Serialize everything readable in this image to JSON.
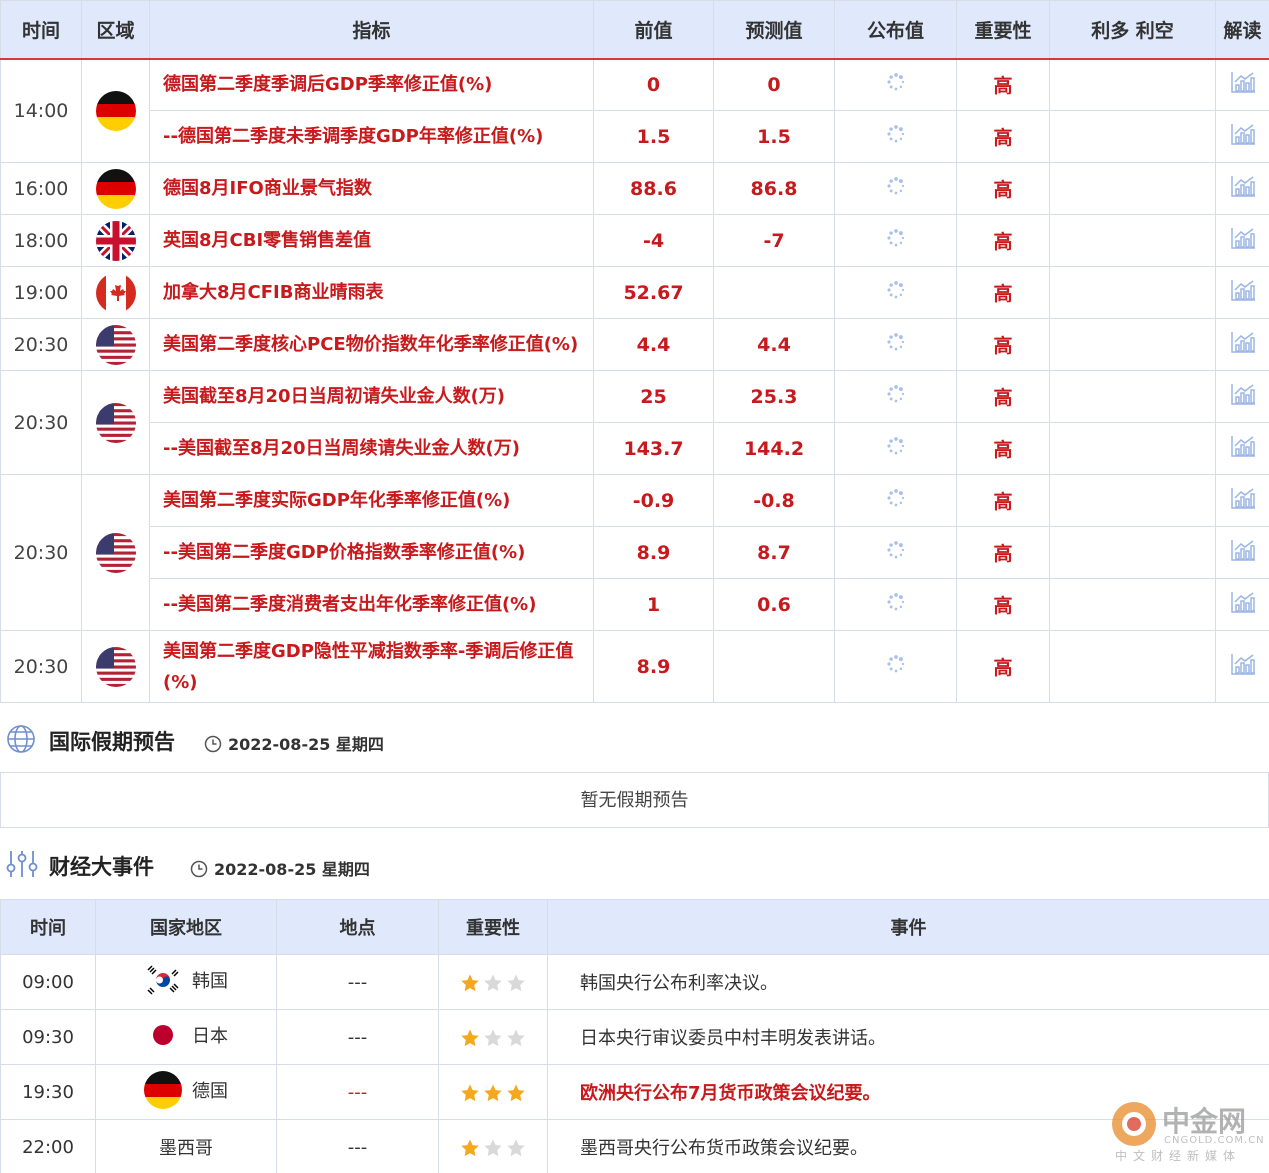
{
  "econ_table": {
    "headers": {
      "time": "时间",
      "region": "区域",
      "indicator": "指标",
      "previous": "前值",
      "forecast": "预测值",
      "actual": "公布值",
      "importance": "重要性",
      "bull_bear": "利多 利空",
      "analysis": "解读"
    },
    "groups": [
      {
        "time": "14:00",
        "flag": "de",
        "rows": [
          {
            "indicator": "德国第二季度季调后GDP季率修正值(%)",
            "previous": "0",
            "forecast": "0",
            "importance": "高"
          },
          {
            "indicator": "--德国第二季度未季调季度GDP年率修正值(%)",
            "previous": "1.5",
            "forecast": "1.5",
            "importance": "高"
          }
        ]
      },
      {
        "time": "16:00",
        "flag": "de",
        "rows": [
          {
            "indicator": "德国8月IFO商业景气指数",
            "previous": "88.6",
            "forecast": "86.8",
            "importance": "高"
          }
        ]
      },
      {
        "time": "18:00",
        "flag": "gb",
        "rows": [
          {
            "indicator": "英国8月CBI零售销售差值",
            "previous": "-4",
            "forecast": "-7",
            "importance": "高"
          }
        ]
      },
      {
        "time": "19:00",
        "flag": "ca",
        "rows": [
          {
            "indicator": "加拿大8月CFIB商业晴雨表",
            "previous": "52.67",
            "forecast": "",
            "importance": "高"
          }
        ]
      },
      {
        "time": "20:30",
        "flag": "us",
        "rows": [
          {
            "indicator": "美国第二季度核心PCE物价指数年化季率修正值(%)",
            "previous": "4.4",
            "forecast": "4.4",
            "importance": "高"
          }
        ]
      },
      {
        "time": "20:30",
        "flag": "us",
        "rows": [
          {
            "indicator": "美国截至8月20日当周初请失业金人数(万)",
            "previous": "25",
            "forecast": "25.3",
            "importance": "高"
          },
          {
            "indicator": "--美国截至8月20日当周续请失业金人数(万)",
            "previous": "143.7",
            "forecast": "144.2",
            "importance": "高"
          }
        ]
      },
      {
        "time": "20:30",
        "flag": "us",
        "rows": [
          {
            "indicator": "美国第二季度实际GDP年化季率修正值(%)",
            "previous": "-0.9",
            "forecast": "-0.8",
            "importance": "高"
          },
          {
            "indicator": "--美国第二季度GDP价格指数季率修正值(%)",
            "previous": "8.9",
            "forecast": "8.7",
            "importance": "高"
          },
          {
            "indicator": "--美国第二季度消费者支出年化季率修正值(%)",
            "previous": "1",
            "forecast": "0.6",
            "importance": "高"
          }
        ]
      },
      {
        "time": "20:30",
        "flag": "us",
        "tall": true,
        "rows": [
          {
            "indicator": "美国第二季度GDP隐性平减指数季率-季调后修正值(%)",
            "previous": "8.9",
            "forecast": "",
            "importance": "高"
          }
        ]
      }
    ]
  },
  "holiday_section": {
    "title": "国际假期预告",
    "date": "2022-08-25 星期四",
    "empty_text": "暂无假期预告"
  },
  "events_section": {
    "title": "财经大事件",
    "date": "2022-08-25 星期四",
    "headers": {
      "time": "时间",
      "country": "国家地区",
      "location": "地点",
      "importance": "重要性",
      "event": "事件"
    },
    "rows": [
      {
        "time": "09:00",
        "flag": "kr",
        "country": "韩国",
        "location": "---",
        "stars": 1,
        "event": "韩国央行公布利率决议。",
        "highlight": false
      },
      {
        "time": "09:30",
        "flag": "jp",
        "country": "日本",
        "location": "---",
        "stars": 1,
        "event": "日本央行审议委员中村丰明发表讲话。",
        "highlight": false
      },
      {
        "time": "19:30",
        "flag": "de",
        "country": "德国",
        "location": "---",
        "stars": 3,
        "event": "欧洲央行公布7月货币政策会议纪要。",
        "highlight": true
      },
      {
        "time": "22:00",
        "flag": "",
        "country": "墨西哥",
        "location": "---",
        "stars": 1,
        "event": "墨西哥央行公布货币政策会议纪要。",
        "highlight": false
      }
    ]
  },
  "watermark": {
    "name": "中金网",
    "site": "CNGOLD.COM.CN",
    "sub": "中文财经新媒体"
  },
  "colors": {
    "accent_red": "#c8191c",
    "header_bg": "#dfe9fb",
    "star_gold": "#f4a81d",
    "star_grey": "#d9d9d9"
  }
}
